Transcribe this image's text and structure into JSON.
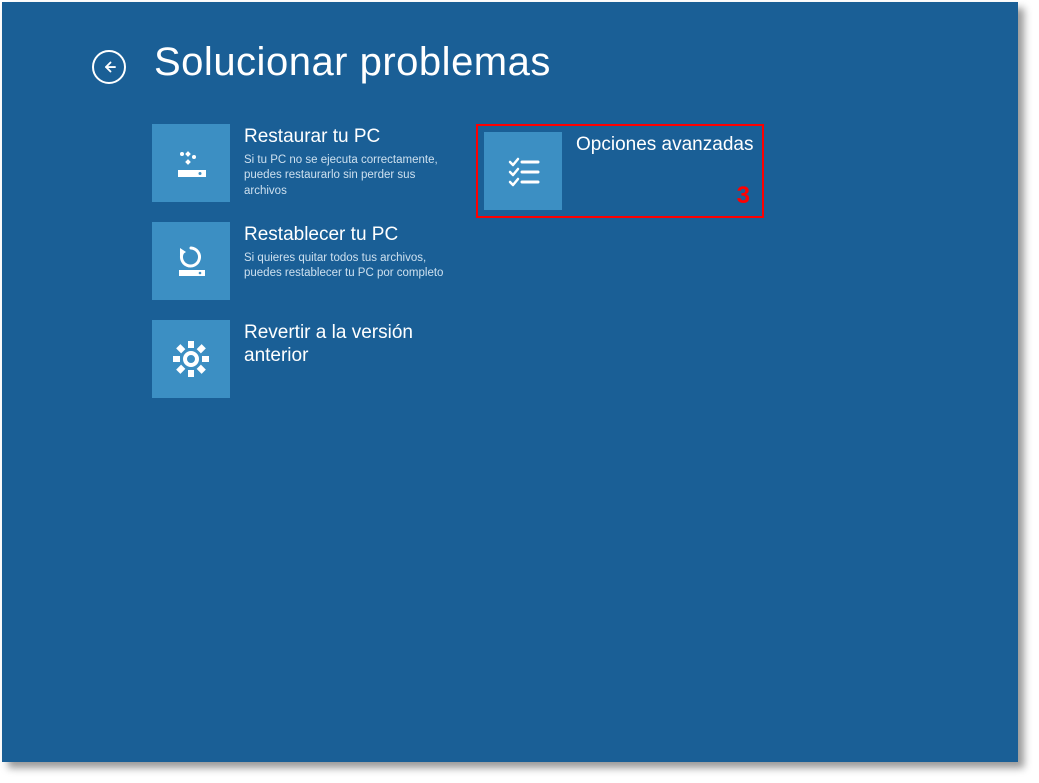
{
  "header": {
    "title": "Solucionar problemas"
  },
  "options": {
    "restore": {
      "title": "Restaurar tu PC",
      "desc": "Si tu PC no se ejecuta correctamente, puedes restaurarlo sin perder sus archivos"
    },
    "reset": {
      "title": "Restablecer tu PC",
      "desc": "Si quieres quitar todos tus archivos, puedes restablecer tu PC por completo"
    },
    "revert": {
      "title": "Revertir a la versión anterior",
      "desc": ""
    },
    "advanced": {
      "title": "Opciones avanzadas",
      "desc": ""
    }
  },
  "annotation": {
    "number": "3"
  }
}
